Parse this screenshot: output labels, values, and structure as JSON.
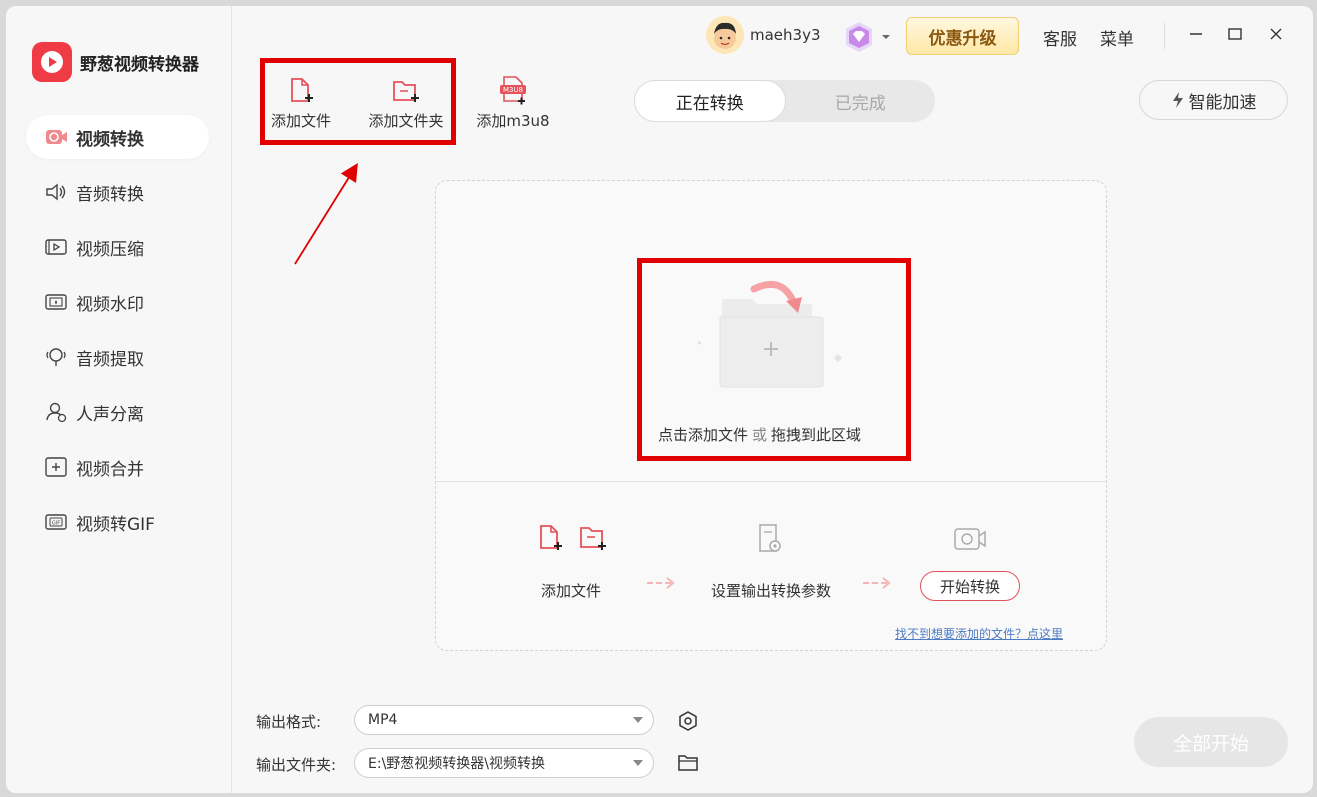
{
  "app": {
    "name": "野葱视频转换器"
  },
  "sidebar": {
    "items": [
      {
        "label": "视频转换",
        "icon": "video-convert-icon",
        "active": true
      },
      {
        "label": "音频转换",
        "icon": "audio-convert-icon"
      },
      {
        "label": "视频压缩",
        "icon": "video-compress-icon"
      },
      {
        "label": "视频水印",
        "icon": "video-watermark-icon"
      },
      {
        "label": "音频提取",
        "icon": "audio-extract-icon"
      },
      {
        "label": "人声分离",
        "icon": "vocal-separation-icon"
      },
      {
        "label": "视频合并",
        "icon": "video-merge-icon"
      },
      {
        "label": "视频转GIF",
        "icon": "video-to-gif-icon"
      }
    ]
  },
  "header": {
    "username": "maeh3y3",
    "upgrade_label": "优惠升级",
    "support_label": "客服",
    "menu_label": "菜单"
  },
  "toolbar": {
    "add_file": "添加文件",
    "add_folder": "添加文件夹",
    "add_m3u8": "添加m3u8",
    "m3u8_badge": "M3U8"
  },
  "tabs": {
    "converting": "正在转换",
    "completed": "已完成"
  },
  "accelerate_label": "智能加速",
  "dropzone": {
    "hint_click": "点击添加文件",
    "hint_or": "或",
    "hint_drag": "拖拽到此区域",
    "steps": {
      "add_file": "添加文件",
      "set_params": "设置输出转换参数",
      "start": "开始转换"
    },
    "help_link": "找不到想要添加的文件？点这里"
  },
  "output": {
    "format_label": "输出格式:",
    "format_value": "MP4",
    "folder_label": "输出文件夹:",
    "folder_value": "E:\\野葱视频转换器\\视频转换"
  },
  "start_all_label": "全部开始",
  "colors": {
    "brand": "#ee3b45",
    "annotation": "#e00000"
  }
}
